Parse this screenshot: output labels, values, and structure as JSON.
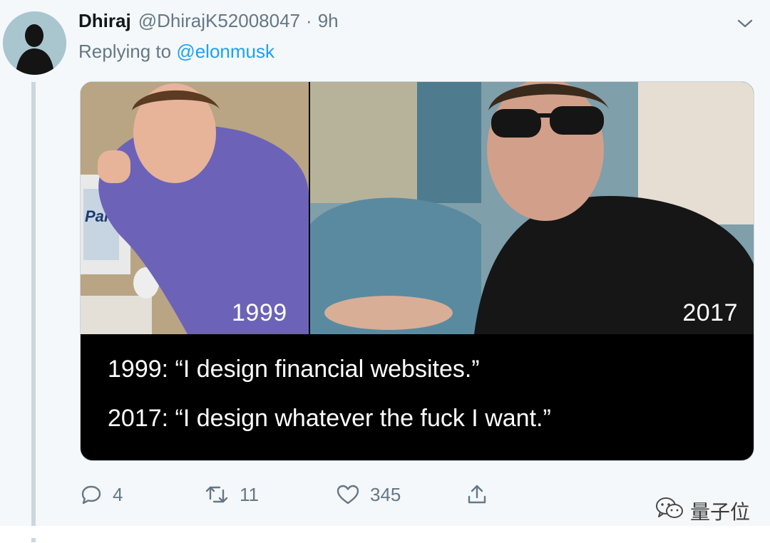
{
  "tweet": {
    "author_name": "Dhiraj",
    "author_handle": "@DhirajK52008047",
    "separator": "·",
    "time": "9h",
    "replying_prefix": "Replying to",
    "replying_to": "@elonmusk",
    "menu_icon": "chevron-down-icon",
    "avatar_icon": "avatar-silhouette"
  },
  "media": {
    "year_left": "1999",
    "year_right": "2017",
    "line_1": "1999: “I design financial websites.”",
    "line_2": "2017: “I design whatever the fuck I want.”",
    "photo_left_text": "Pal"
  },
  "actions": {
    "reply_count": "4",
    "retweet_count": "11",
    "like_count": "345",
    "reply_icon": "reply-icon",
    "retweet_icon": "retweet-icon",
    "like_icon": "heart-icon",
    "share_icon": "share-icon"
  },
  "watermark": {
    "text": "量子位",
    "icon": "wechat-icon"
  },
  "colors": {
    "background": "#f5f8fa",
    "accent": "#1da1f2",
    "secondary_text": "#657786",
    "primary_text": "#14171a"
  }
}
